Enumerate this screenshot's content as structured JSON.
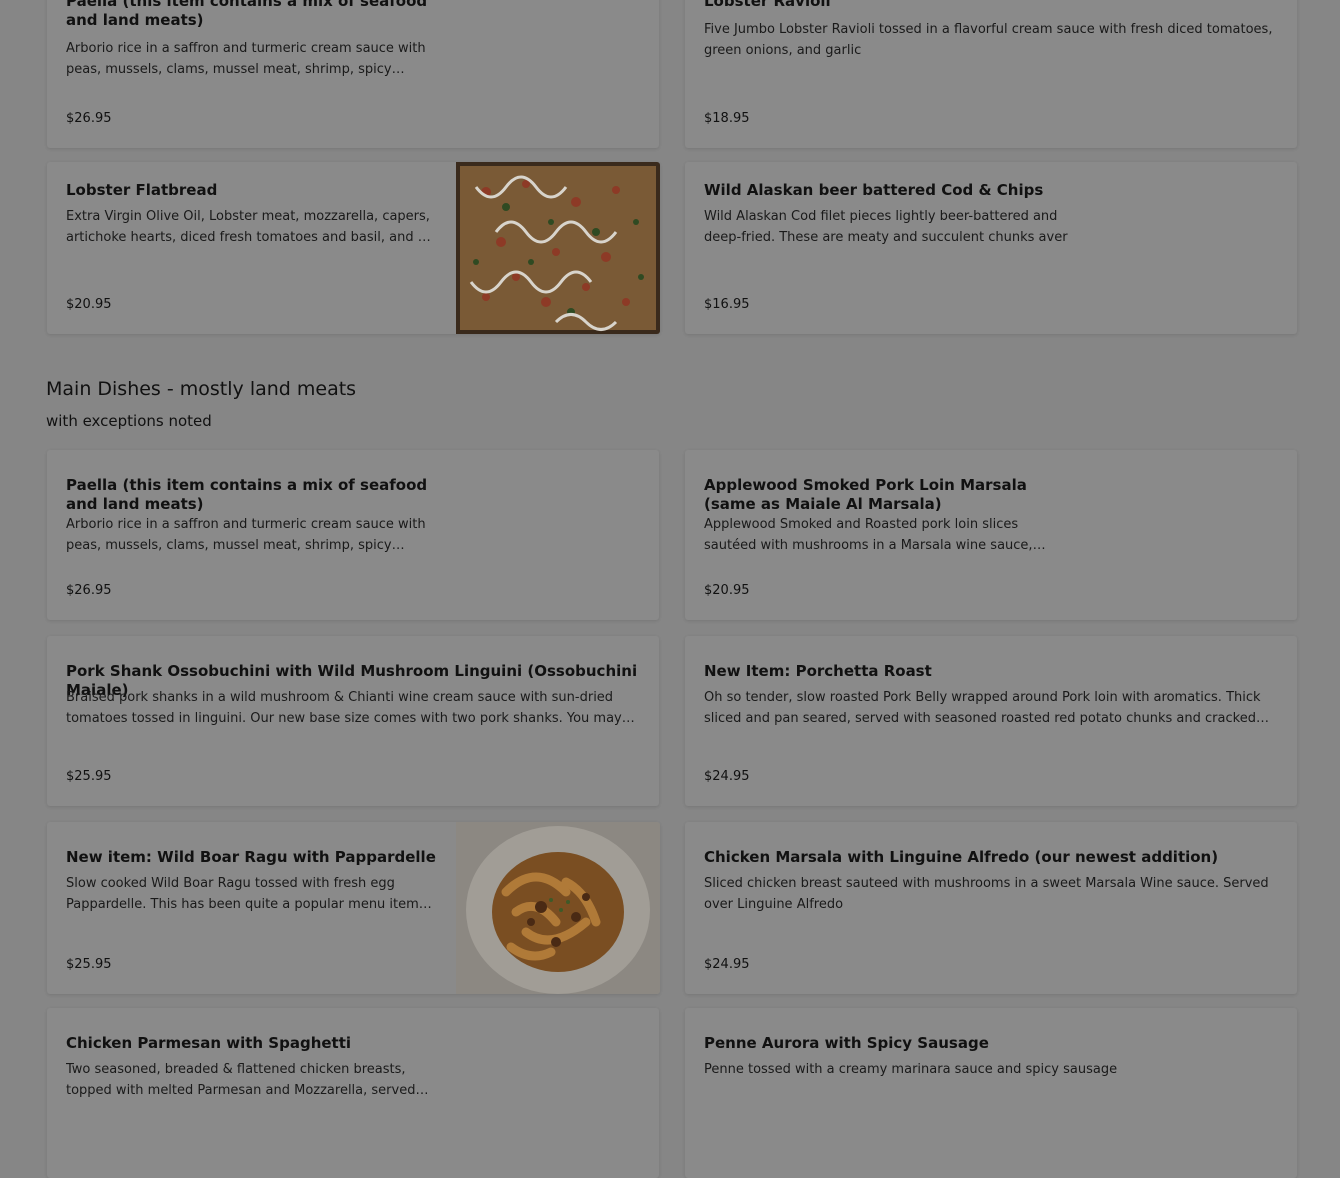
{
  "top_cards": [
    {
      "title": "Paella (this item contains a mix of seafood and land meats)",
      "desc": "Arborio rice in a saffron and turmeric cream sauce with peas, mussels, clams, mussel meat, shrimp, spicy sausage",
      "price": "$26.95"
    },
    {
      "title": "Lobster Ravioli",
      "desc": "Five Jumbo Lobster Ravioli tossed in a flavorful cream sauce with fresh diced tomatoes, green onions, and garlic",
      "price": "$18.95"
    },
    {
      "title": "Lobster Flatbread",
      "desc": "Extra Virgin Olive Oil, Lobster meat, mozzarella, capers, artichoke hearts, diced fresh tomatoes and basil, and a drizzle",
      "price": "$20.95"
    },
    {
      "title": "Wild Alaskan beer battered Cod & Chips",
      "desc": "Wild Alaskan Cod filet pieces lightly beer-battered and deep-fried. These are meaty and succulent chunks aver",
      "price": "$16.95"
    }
  ],
  "section": {
    "title": "Main Dishes - mostly land meats",
    "subtitle": "with exceptions noted"
  },
  "main_cards": [
    {
      "title": "Paella (this item contains a mix of seafood and land meats)",
      "desc": "Arborio rice in a saffron and turmeric cream sauce with peas, mussels, clams, mussel meat, shrimp, spicy sausage",
      "price": "$26.95"
    },
    {
      "title": "Applewood Smoked Pork Loin Marsala (same as Maiale Al Marsala)",
      "desc": "Applewood Smoked and Roasted pork loin slices sautéed with mushrooms in a Marsala wine sauce, served",
      "price": "$20.95"
    },
    {
      "title": "Pork Shank Ossobuchini with Wild Mushroom Linguini (Ossobuchini Maiale)",
      "desc": "Braised pork shanks in a wild mushroom & Chianti wine cream sauce with sun-dried tomatoes tossed in linguini. Our new base size comes with two pork shanks. You may add",
      "price": "$25.95"
    },
    {
      "title": "New Item: Porchetta Roast",
      "desc": "Oh so tender, slow roasted Pork Belly wrapped around Pork loin with aromatics. Thick sliced and pan seared, served with seasoned roasted red potato chunks and cracked pepper",
      "price": "$24.95"
    },
    {
      "title": "New item: Wild Boar Ragu with Pappardelle",
      "desc": "Slow cooked Wild Boar Ragu tossed with fresh egg Pappardelle. This has been quite a popular menu item for",
      "price": "$25.95"
    },
    {
      "title": "Chicken Marsala with Linguine Alfredo (our newest addition)",
      "desc": "Sliced chicken breast sauteed with mushrooms in a sweet Marsala Wine sauce. Served over Linguine Alfredo",
      "price": "$24.95"
    },
    {
      "title": "Chicken Parmesan with Spaghetti",
      "desc": "Two seasoned, breaded & flattened chicken breasts, topped with melted Parmesan and Mozzarella, served over",
      "price": ""
    },
    {
      "title": "Penne Aurora with Spicy Sausage",
      "desc": "Penne tossed with a creamy marinara sauce and spicy sausage",
      "price": ""
    }
  ]
}
